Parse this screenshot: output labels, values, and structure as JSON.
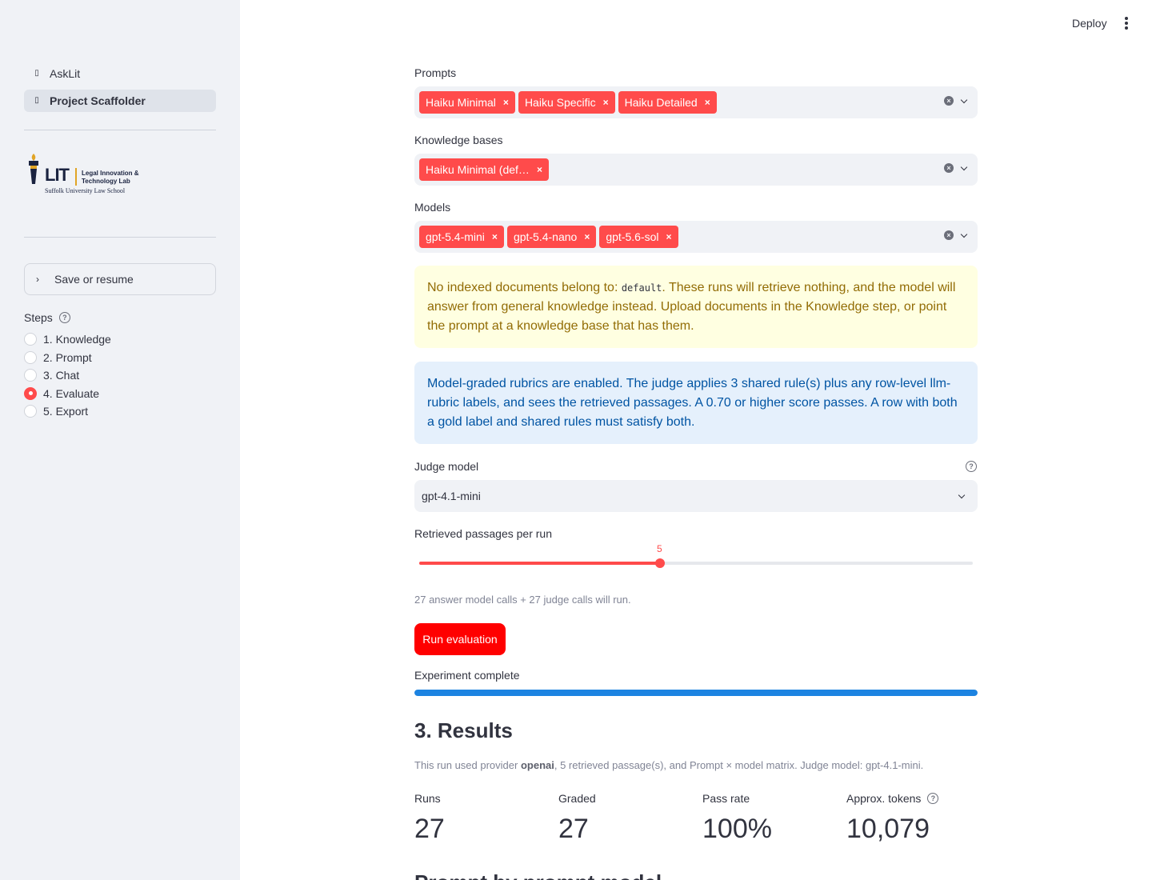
{
  "sidebar": {
    "nav": [
      {
        "label": "AskLit",
        "active": false
      },
      {
        "label": "Project Scaffolder",
        "active": true
      }
    ],
    "logo": {
      "mark": "LIT",
      "lab_line1": "Legal Innovation &",
      "lab_line2": "Technology Lab",
      "school": "Suffolk University Law School"
    },
    "save_resume": "Save or resume",
    "steps_label": "Steps",
    "steps": [
      {
        "label": "1. Knowledge",
        "checked": false
      },
      {
        "label": "2. Prompt",
        "checked": false
      },
      {
        "label": "3. Chat",
        "checked": false
      },
      {
        "label": "4. Evaluate",
        "checked": true
      },
      {
        "label": "5. Export",
        "checked": false
      }
    ]
  },
  "header": {
    "deploy_label": "Deploy"
  },
  "main": {
    "prompts_label": "Prompts",
    "prompts": [
      "Haiku Minimal",
      "Haiku Specific",
      "Haiku Detailed"
    ],
    "kb_label": "Knowledge bases",
    "kbs": [
      "Haiku Minimal (def…"
    ],
    "models_label": "Models",
    "models": [
      "gpt-5.4-mini",
      "gpt-5.4-nano",
      "gpt-5.6-sol"
    ],
    "warning": {
      "before": "No indexed documents belong to: ",
      "code": "default",
      "after": ". These runs will retrieve nothing, and the model will answer from general knowledge instead. Upload documents in the Knowledge step, or point the prompt at a knowledge base that has them."
    },
    "info": "Model-graded rubrics are enabled. The judge applies 3 shared rule(s) plus any row-level llm-rubric labels, and sees the retrieved passages. A 0.70 or higher score passes. A row with both a gold label and shared rules must satisfy both.",
    "judge_label": "Judge model",
    "judge_value": "gpt-4.1-mini",
    "passages_label": "Retrieved passages per run",
    "slider": {
      "value": "5",
      "min": 1,
      "max": 10,
      "num": 5
    },
    "calls_caption": "27 answer model calls + 27 judge calls will run.",
    "run_button": "Run evaluation",
    "progress_label": "Experiment complete",
    "progress": 1.0,
    "results_title": "3. Results",
    "results_caption": {
      "pre": "This run used provider ",
      "provider": "openai",
      "post": ", 5 retrieved passage(s), and Prompt × model matrix. Judge model: gpt-4.1-mini."
    },
    "metrics": [
      {
        "label": "Runs",
        "value": "27"
      },
      {
        "label": "Graded",
        "value": "27"
      },
      {
        "label": "Pass rate",
        "value": "100%"
      },
      {
        "label": "Approx. tokens",
        "value": "10,079"
      }
    ],
    "next_heading": "Prompt by prompt model"
  }
}
